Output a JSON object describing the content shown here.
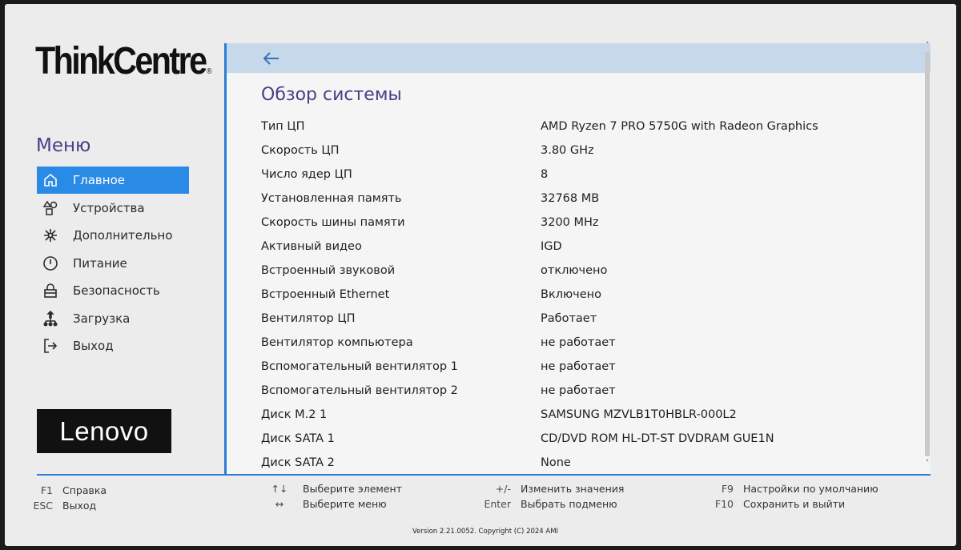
{
  "brand": {
    "product_logo": "ThinkCentre",
    "vendor_logo": "Lenovo"
  },
  "menu": {
    "title": "Меню",
    "items": [
      {
        "label": "Главное",
        "icon": "home-icon",
        "active": true
      },
      {
        "label": "Устройства",
        "icon": "devices-icon",
        "active": false
      },
      {
        "label": "Дополнительно",
        "icon": "advanced-icon",
        "active": false
      },
      {
        "label": "Питание",
        "icon": "power-icon",
        "active": false
      },
      {
        "label": "Безопасность",
        "icon": "lock-icon",
        "active": false
      },
      {
        "label": "Загрузка",
        "icon": "boot-icon",
        "active": false
      },
      {
        "label": "Выход",
        "icon": "exit-icon",
        "active": false
      }
    ]
  },
  "content": {
    "title": "Обзор системы",
    "rows": [
      {
        "label": "Тип ЦП",
        "value": "AMD Ryzen 7 PRO 5750G with Radeon Graphics"
      },
      {
        "label": "Скорость ЦП",
        "value": "3.80 GHz"
      },
      {
        "label": "Число ядер ЦП",
        "value": "8"
      },
      {
        "label": "Установленная память",
        "value": "32768 MB"
      },
      {
        "label": "Скорость шины памяти",
        "value": "3200 MHz"
      },
      {
        "label": "Активный видео",
        "value": "IGD"
      },
      {
        "label": "Встроенный звуковой",
        "value": "отключено"
      },
      {
        "label": "Встроенный Ethernet",
        "value": "Включено"
      },
      {
        "label": "Вентилятор ЦП",
        "value": "Работает"
      },
      {
        "label": "Вентилятор компьютера",
        "value": "не работает"
      },
      {
        "label": "Вспомогательный вентилятор 1",
        "value": "не работает"
      },
      {
        "label": "Вспомогательный вентилятор 2",
        "value": "не работает"
      },
      {
        "label": "Диск M.2 1",
        "value": "SAMSUNG MZVLB1T0HBLR-000L2"
      },
      {
        "label": "Диск SATA 1",
        "value": "CD/DVD ROM HL-DT-ST DVDRAM GUE1N"
      },
      {
        "label": "Диск SATA 2",
        "value": "None"
      }
    ]
  },
  "footer": {
    "hotkeys": [
      {
        "key": "F1",
        "desc": "Справка"
      },
      {
        "key": "ESC",
        "desc": "Выход"
      },
      {
        "key": "↑↓",
        "desc": "Выберите элемент"
      },
      {
        "key": "↔",
        "desc": "Выберите меню"
      },
      {
        "key": "+/-",
        "desc": "Изменить значения"
      },
      {
        "key": "Enter",
        "desc": "Выбрать подменю"
      },
      {
        "key": "F9",
        "desc": "Настройки по умолчанию"
      },
      {
        "key": "F10",
        "desc": "Сохранить и выйти"
      }
    ],
    "version": "Version 2.21.0052. Copyright (C) 2024 AMI"
  },
  "colors": {
    "accent": "#2a7fd4",
    "active_menu": "#2a8be6",
    "title_purple": "#4f3b87",
    "header_band": "#c5d9ea"
  }
}
